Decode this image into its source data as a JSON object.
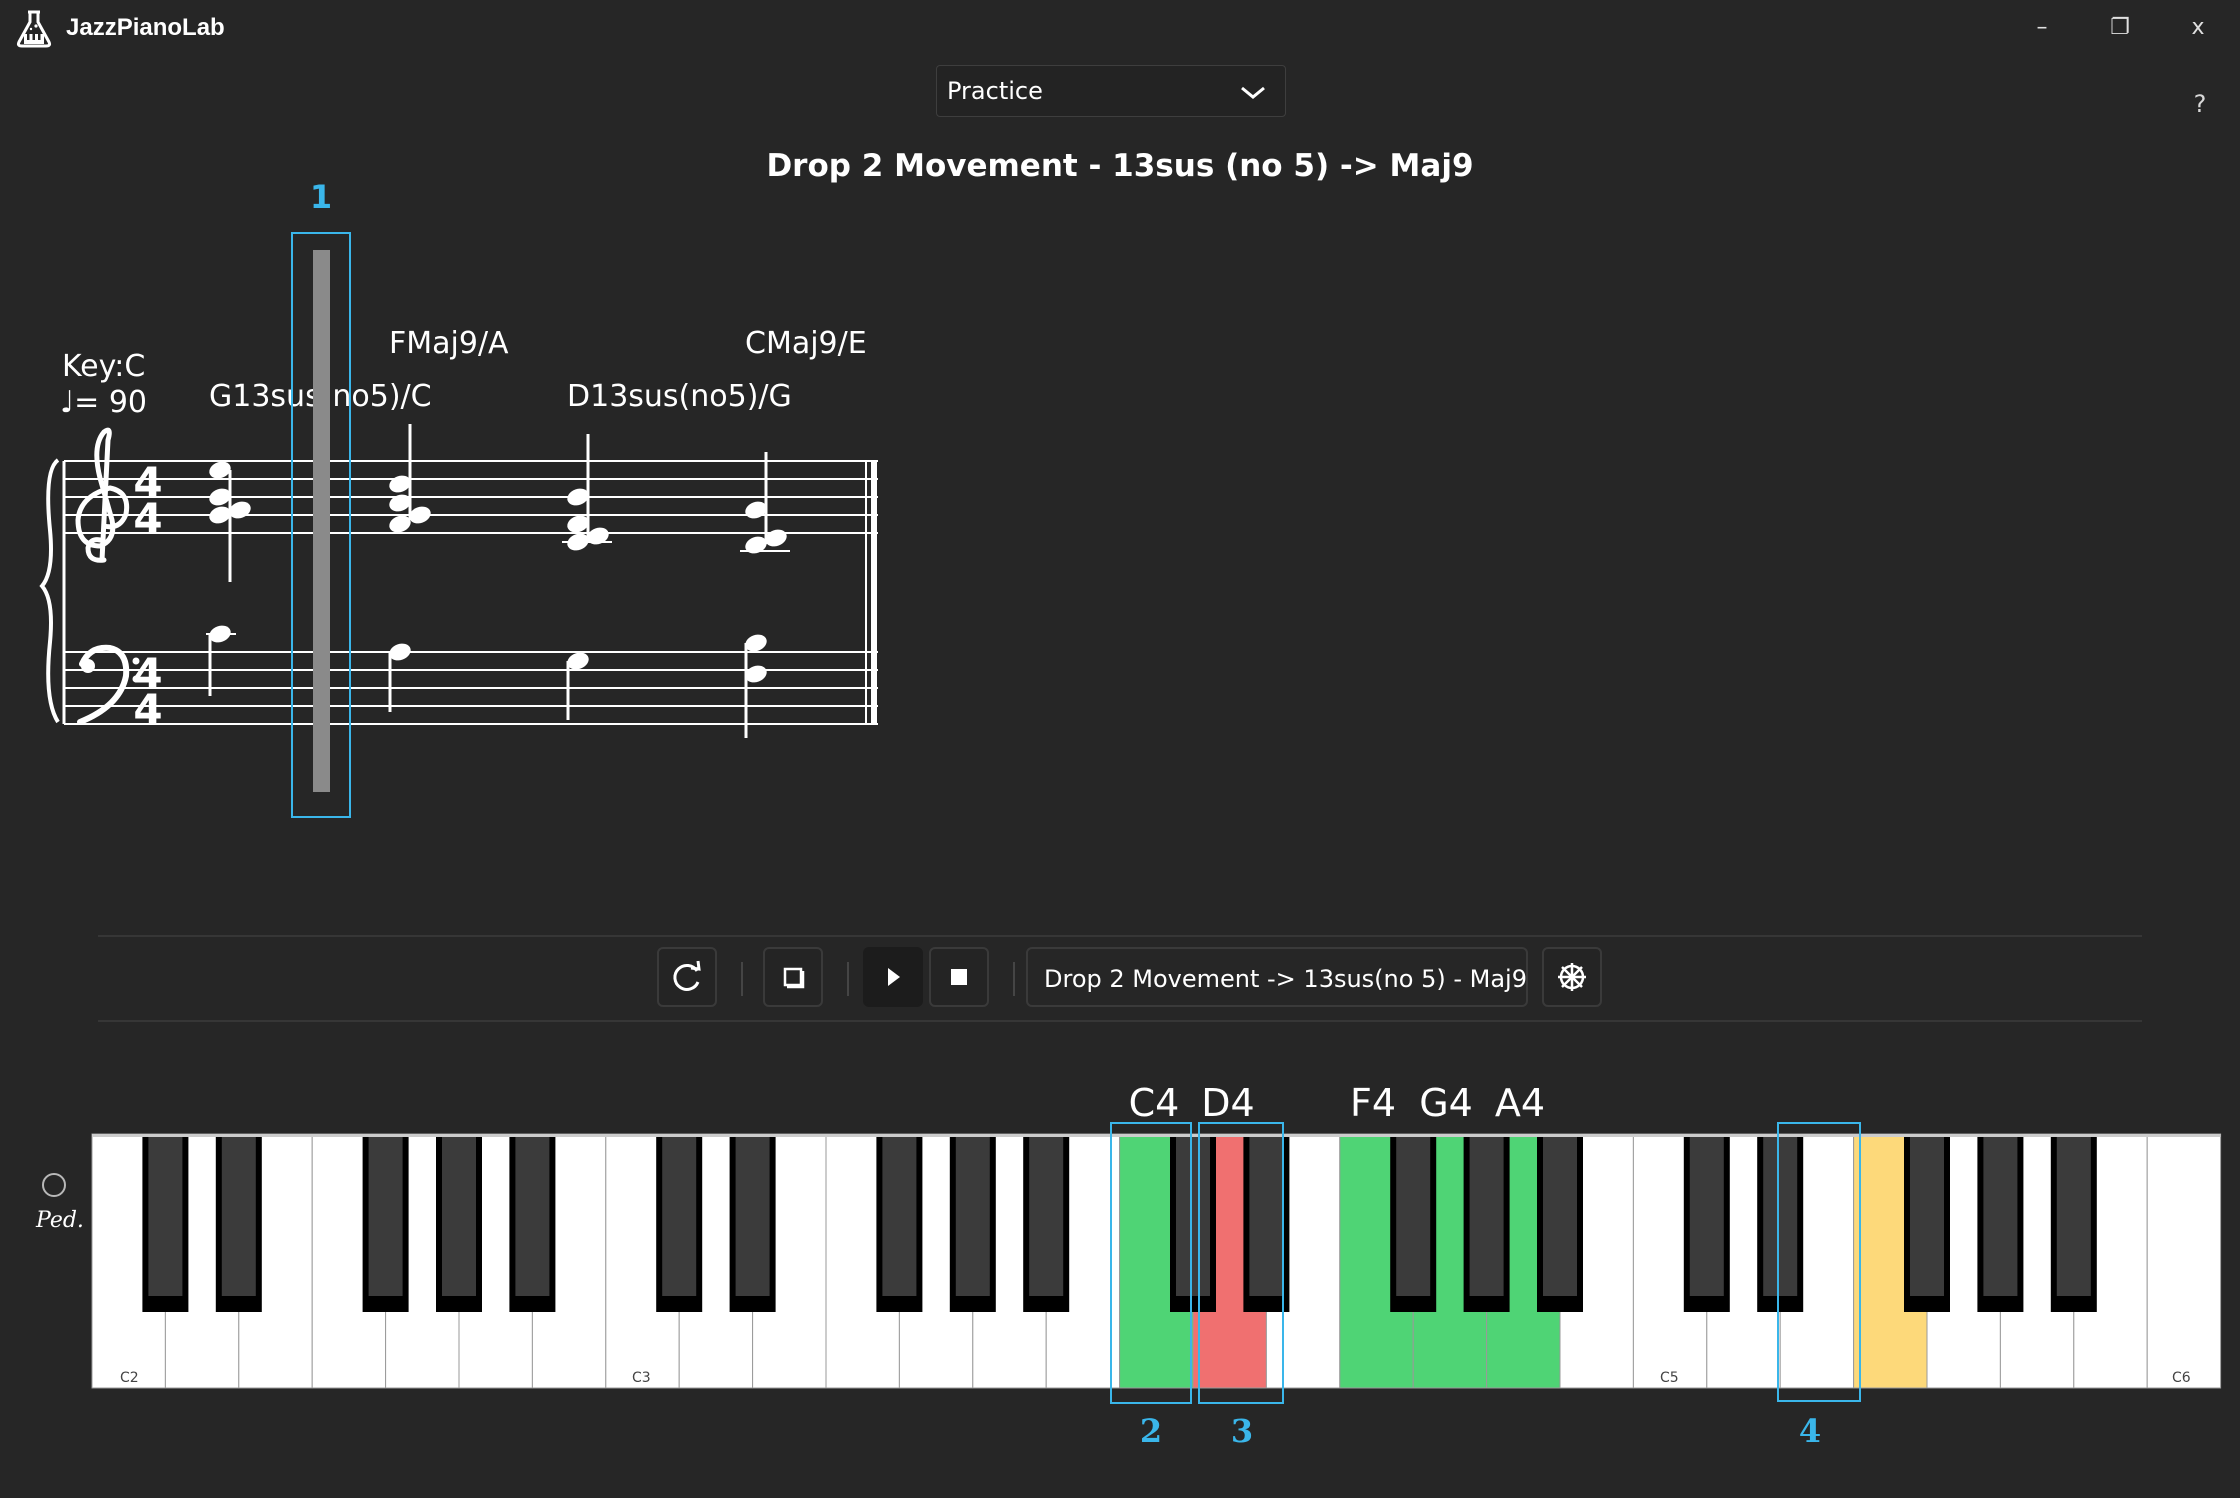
{
  "app": {
    "title": "JazzPianoLab",
    "window_controls": {
      "minimize": "–",
      "maximize": "❐",
      "close": "x"
    },
    "help": "?"
  },
  "mode_select": {
    "value": "Practice"
  },
  "exercise_title": "Drop 2 Movement - 13sus (no 5) -> Maj9",
  "score": {
    "key": "Key:C",
    "tempo": "♩= 90",
    "chord_symbols": [
      {
        "label": "G13sus(no5)/C",
        "row": "lower"
      },
      {
        "label": "FMaj9/A",
        "row": "upper"
      },
      {
        "label": "D13sus(no5)/G",
        "row": "lower"
      },
      {
        "label": "CMaj9/E",
        "row": "upper"
      }
    ],
    "time_signature": {
      "top": "4",
      "bottom": "4"
    },
    "cursor_marker": "1"
  },
  "toolbar": {
    "buttons": [
      {
        "name": "loop-button",
        "icon": "loop-icon"
      },
      {
        "name": "metronome-toggle-button",
        "icon": "square-outline-icon"
      },
      {
        "name": "play-button",
        "icon": "play-icon"
      },
      {
        "name": "stop-button",
        "icon": "stop-icon"
      },
      {
        "name": "settings-button",
        "icon": "wheel-icon"
      }
    ],
    "exercise_label": "Drop 2 Movement -> 13sus(no 5) - Maj9"
  },
  "keyboard": {
    "octave_labels": [
      "C2",
      "C3",
      "C5",
      "C6"
    ],
    "pressed_note_labels": [
      "C4",
      "D4",
      "F4",
      "G4",
      "A4"
    ],
    "markers": [
      "2",
      "3",
      "4"
    ],
    "colors": {
      "correct": "#4fd475",
      "wrong": "#f07070",
      "hint": "#fdd97a",
      "marker": "#3ab6ea"
    },
    "pedal_icon": "Ped."
  }
}
